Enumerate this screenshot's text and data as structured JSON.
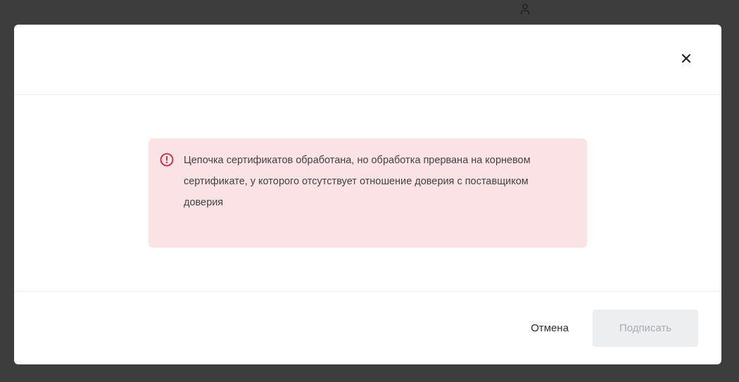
{
  "dialog": {
    "alert": {
      "kind": "error",
      "text": "Цепочка сертификатов обработана, но обработка прервана на корневом сертификате, у которого отсутствует отношение доверия с поставщиком доверия"
    },
    "buttons": [
      {
        "label": "Отмена",
        "kind": "text",
        "disabled": false
      },
      {
        "label": "Подписать",
        "kind": "filled",
        "disabled": true
      }
    ]
  }
}
